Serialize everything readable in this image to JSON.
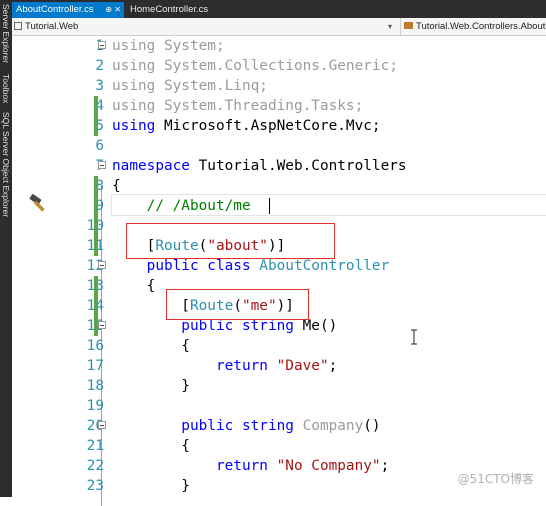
{
  "sidebar": {
    "items": [
      "Server Explorer",
      "Toolbox",
      "SQL Server Object Explorer"
    ]
  },
  "tabs": [
    {
      "label": "AboutController.cs",
      "icons": "⊕ ✕",
      "active": true
    },
    {
      "label": "HomeController.cs",
      "active": false
    }
  ],
  "navbar": {
    "project": "Tutorial.Web",
    "class_path": "Tutorial.Web.Controllers.AboutC"
  },
  "colors": {
    "keyword": "#0000ff",
    "type": "#2b91af",
    "string": "#a31515",
    "comment": "#008000",
    "line_number": "#2b91af",
    "change_bar": "#57a64a",
    "highlight_box": "#e0322b",
    "active_tab": "#007acc"
  },
  "icons": {
    "quick_action": "hammer-icon",
    "mouse_cursor": "ibeam-cursor-icon"
  },
  "code": {
    "lines": [
      {
        "n": "1",
        "parts": [
          {
            "t": "using System;",
            "c": "gr"
          }
        ]
      },
      {
        "n": "2",
        "parts": [
          {
            "t": "using System.Collections.Generic;",
            "c": "gr"
          }
        ]
      },
      {
        "n": "3",
        "parts": [
          {
            "t": "using System.Linq;",
            "c": "gr"
          }
        ]
      },
      {
        "n": "4",
        "parts": [
          {
            "t": "using System.Threading.Tasks;",
            "c": "gr"
          }
        ]
      },
      {
        "n": "5",
        "parts": [
          {
            "t": "using",
            "c": "kw"
          },
          {
            "t": " Microsoft.AspNetCore.Mvc;",
            "c": "tx"
          }
        ]
      },
      {
        "n": "6",
        "parts": []
      },
      {
        "n": "7",
        "parts": [
          {
            "t": "namespace",
            "c": "kw"
          },
          {
            "t": " Tutorial.Web.Controllers",
            "c": "tx"
          }
        ]
      },
      {
        "n": "8",
        "parts": [
          {
            "t": "{",
            "c": "tx"
          }
        ]
      },
      {
        "n": "9",
        "parts": [
          {
            "t": "    // /About/me",
            "c": "cm"
          }
        ]
      },
      {
        "n": "10",
        "parts": []
      },
      {
        "n": "11",
        "parts": [
          {
            "t": "    [",
            "c": "tx"
          },
          {
            "t": "Route",
            "c": "ty"
          },
          {
            "t": "(",
            "c": "tx"
          },
          {
            "t": "\"about\"",
            "c": "st"
          },
          {
            "t": ")]",
            "c": "tx"
          }
        ]
      },
      {
        "n": "12",
        "parts": [
          {
            "t": "    public class",
            "c": "kw"
          },
          {
            "t": " AboutController",
            "c": "ty"
          }
        ]
      },
      {
        "n": "13",
        "parts": [
          {
            "t": "    {",
            "c": "tx"
          }
        ]
      },
      {
        "n": "14",
        "parts": [
          {
            "t": "        [",
            "c": "tx"
          },
          {
            "t": "Route",
            "c": "ty"
          },
          {
            "t": "(",
            "c": "tx"
          },
          {
            "t": "\"me\"",
            "c": "st"
          },
          {
            "t": ")]",
            "c": "tx"
          }
        ]
      },
      {
        "n": "15",
        "parts": [
          {
            "t": "        public string",
            "c": "kw"
          },
          {
            "t": " Me()",
            "c": "tx"
          }
        ]
      },
      {
        "n": "16",
        "parts": [
          {
            "t": "        {",
            "c": "tx"
          }
        ]
      },
      {
        "n": "17",
        "parts": [
          {
            "t": "            return",
            "c": "kw"
          },
          {
            "t": " ",
            "c": "tx"
          },
          {
            "t": "\"Dave\"",
            "c": "st"
          },
          {
            "t": ";",
            "c": "tx"
          }
        ]
      },
      {
        "n": "18",
        "parts": [
          {
            "t": "        }",
            "c": "tx"
          }
        ]
      },
      {
        "n": "19",
        "parts": []
      },
      {
        "n": "20",
        "parts": [
          {
            "t": "        public string",
            "c": "kw"
          },
          {
            "t": " Company",
            "c": "gr"
          },
          {
            "t": "()",
            "c": "tx"
          }
        ]
      },
      {
        "n": "21",
        "parts": [
          {
            "t": "        {",
            "c": "tx"
          }
        ]
      },
      {
        "n": "22",
        "parts": [
          {
            "t": "            return",
            "c": "kw"
          },
          {
            "t": " ",
            "c": "tx"
          },
          {
            "t": "\"No Company\"",
            "c": "st"
          },
          {
            "t": ";",
            "c": "tx"
          }
        ]
      },
      {
        "n": "23",
        "parts": [
          {
            "t": "        }",
            "c": "tx"
          }
        ]
      }
    ]
  },
  "watermark": "@51CTO博客"
}
